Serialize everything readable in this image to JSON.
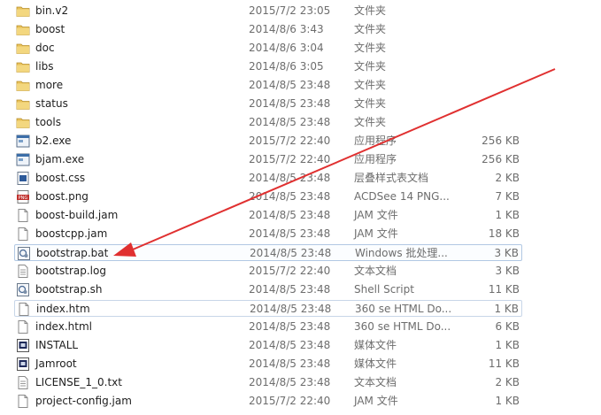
{
  "files": [
    {
      "name": "bin.v2",
      "date": "2015/7/2 23:05",
      "type": "文件夹",
      "size": "",
      "icon": "folder-icon"
    },
    {
      "name": "boost",
      "date": "2014/8/6 3:43",
      "type": "文件夹",
      "size": "",
      "icon": "folder-icon"
    },
    {
      "name": "doc",
      "date": "2014/8/6 3:04",
      "type": "文件夹",
      "size": "",
      "icon": "folder-icon"
    },
    {
      "name": "libs",
      "date": "2014/8/6 3:05",
      "type": "文件夹",
      "size": "",
      "icon": "folder-icon"
    },
    {
      "name": "more",
      "date": "2014/8/5 23:48",
      "type": "文件夹",
      "size": "",
      "icon": "folder-icon"
    },
    {
      "name": "status",
      "date": "2014/8/5 23:48",
      "type": "文件夹",
      "size": "",
      "icon": "folder-icon"
    },
    {
      "name": "tools",
      "date": "2014/8/5 23:48",
      "type": "文件夹",
      "size": "",
      "icon": "folder-icon"
    },
    {
      "name": "b2.exe",
      "date": "2015/7/2 22:40",
      "type": "应用程序",
      "size": "256 KB",
      "icon": "exe-icon"
    },
    {
      "name": "bjam.exe",
      "date": "2015/7/2 22:40",
      "type": "应用程序",
      "size": "256 KB",
      "icon": "exe-icon"
    },
    {
      "name": "boost.css",
      "date": "2014/8/5 23:48",
      "type": "层叠样式表文档",
      "size": "2 KB",
      "icon": "css-icon"
    },
    {
      "name": "boost.png",
      "date": "2014/8/5 23:48",
      "type": "ACDSee 14 PNG...",
      "size": "7 KB",
      "icon": "png-icon"
    },
    {
      "name": "boost-build.jam",
      "date": "2014/8/5 23:48",
      "type": "JAM 文件",
      "size": "1 KB",
      "icon": "file-icon"
    },
    {
      "name": "boostcpp.jam",
      "date": "2014/8/5 23:48",
      "type": "JAM 文件",
      "size": "18 KB",
      "icon": "file-icon"
    },
    {
      "name": "bootstrap.bat",
      "date": "2014/8/5 23:48",
      "type": "Windows 批处理...",
      "size": "3 KB",
      "icon": "script-icon",
      "selected": true
    },
    {
      "name": "bootstrap.log",
      "date": "2015/7/2 22:40",
      "type": "文本文档",
      "size": "3 KB",
      "icon": "text-icon"
    },
    {
      "name": "bootstrap.sh",
      "date": "2014/8/5 23:48",
      "type": "Shell Script",
      "size": "11 KB",
      "icon": "script-icon"
    },
    {
      "name": "index.htm",
      "date": "2014/8/5 23:48",
      "type": "360 se HTML Do...",
      "size": "1 KB",
      "icon": "file-icon",
      "hover": true
    },
    {
      "name": "index.html",
      "date": "2014/8/5 23:48",
      "type": "360 se HTML Do...",
      "size": "6 KB",
      "icon": "file-icon"
    },
    {
      "name": "INSTALL",
      "date": "2014/8/5 23:48",
      "type": "媒体文件",
      "size": "1 KB",
      "icon": "media-icon"
    },
    {
      "name": "Jamroot",
      "date": "2014/8/5 23:48",
      "type": "媒体文件",
      "size": "11 KB",
      "icon": "media-icon"
    },
    {
      "name": "LICENSE_1_0.txt",
      "date": "2014/8/5 23:48",
      "type": "文本文档",
      "size": "2 KB",
      "icon": "text-icon"
    },
    {
      "name": "project-config.jam",
      "date": "2015/7/2 22:40",
      "type": "JAM 文件",
      "size": "1 KB",
      "icon": "file-icon"
    }
  ],
  "colors": {
    "annotation_arrow": "#e03030",
    "selection_border": "#b2c8e3",
    "folder": "#e8c15a"
  }
}
